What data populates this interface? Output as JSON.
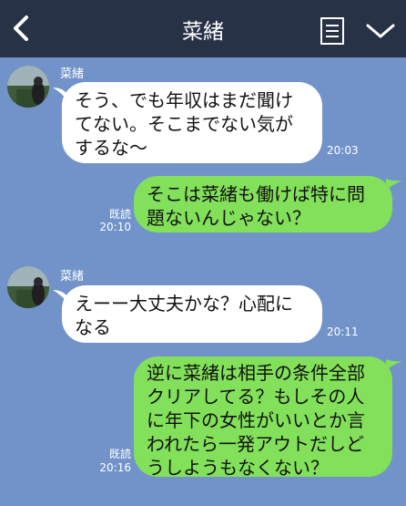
{
  "header": {
    "title": "菜緒",
    "back_icon": "chevron-left-icon",
    "menu_icon": "note-list-icon",
    "expand_icon": "chevron-down-icon"
  },
  "colors": {
    "chat_bg": "#7293c9",
    "header_bg": "#273246",
    "incoming_bubble": "#ffffff",
    "outgoing_bubble": "#82e05a"
  },
  "messages": [
    {
      "direction": "in",
      "sender": "菜緒",
      "text": "そう、でも年収はまだ聞け\nてない。そこまでない気が\nするな〜",
      "time": "20:03"
    },
    {
      "direction": "out",
      "read": "既読",
      "text": "そこは菜緒も働けば特に問\n題ないんじゃない？",
      "time": "20:10"
    },
    {
      "direction": "in",
      "sender": "菜緒",
      "text": "えーー大丈夫かな？心配に\nなる",
      "time": "20:11"
    },
    {
      "direction": "out",
      "read": "既読",
      "text": "逆に菜緒は相手の条件全部\nクリアしてる？もしその人\nに年下の女性がいいとか言\nわれたら一発アウトだしど\nうしようもなくない？",
      "time": "20:16"
    }
  ]
}
